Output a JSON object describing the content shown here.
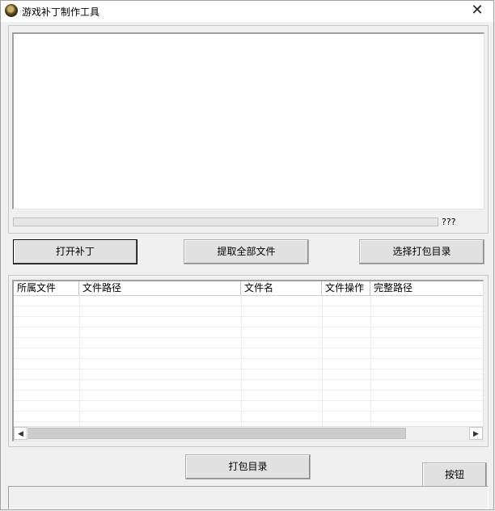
{
  "window": {
    "title": "游戏补丁制作工具",
    "close_label": "✕"
  },
  "progress": {
    "label": "???",
    "value_percent": 0
  },
  "buttons": {
    "open_patch": "打开补丁",
    "extract_all": "提取全部文件",
    "select_pack_dir": "选择打包目录",
    "pack_dir": "打包目录",
    "generic": "按钮"
  },
  "file_list": {
    "columns": [
      "所属文件",
      "文件路径",
      "文件名",
      "文件操作",
      "完整路径"
    ],
    "rows": []
  },
  "scrollbar": {
    "left_arrow": "◀",
    "right_arrow": "▶"
  }
}
